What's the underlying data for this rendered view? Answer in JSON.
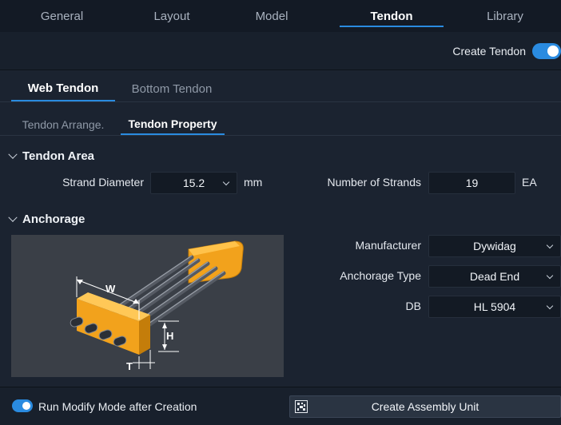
{
  "top_tabs": [
    {
      "label": "General",
      "active": false
    },
    {
      "label": "Layout",
      "active": false
    },
    {
      "label": "Model",
      "active": false
    },
    {
      "label": "Tendon",
      "active": true
    },
    {
      "label": "Library",
      "active": false
    }
  ],
  "create_tendon": {
    "label": "Create Tendon",
    "enabled": true
  },
  "tendon_tabs": [
    "Web Tendon",
    "Bottom Tendon"
  ],
  "property_tabs": [
    "Tendon Arrange.",
    "Tendon Property"
  ],
  "tendon_area": {
    "title": "Tendon Area",
    "strand_diameter_label": "Strand Diameter",
    "strand_diameter_value": "15.2",
    "strand_diameter_unit": "mm",
    "strands_label": "Number of Strands",
    "strands_value": "19",
    "strands_unit": "EA"
  },
  "anchorage": {
    "title": "Anchorage",
    "manufacturer_label": "Manufacturer",
    "manufacturer_value": "Dywidag",
    "type_label": "Anchorage Type",
    "type_value": "Dead End",
    "db_label": "DB",
    "db_value": "HL 5904",
    "diagram_labels": {
      "w": "W",
      "h": "H",
      "t": "T"
    }
  },
  "footer": {
    "run_modify_label": "Run Modify Mode after Creation",
    "run_modify_enabled": true,
    "assembly_button": "Create Assembly Unit"
  },
  "colors": {
    "accent": "#2a8be0",
    "anchor": "#f2a21c"
  }
}
